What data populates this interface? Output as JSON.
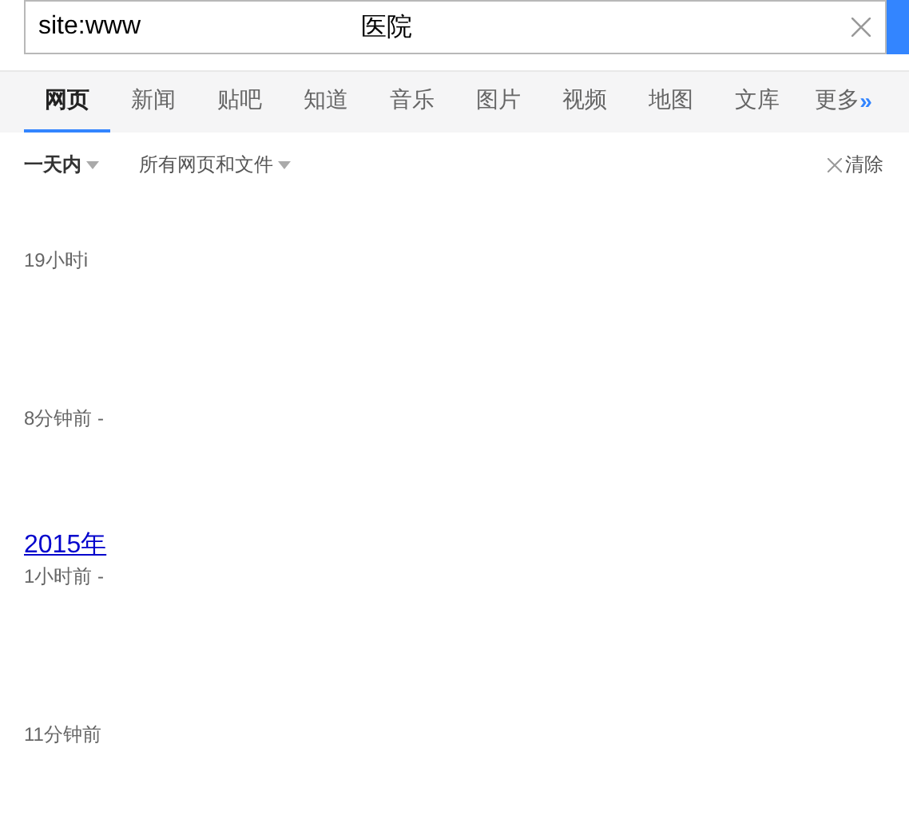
{
  "search": {
    "query_parts": [
      "site:www",
      "医院"
    ]
  },
  "tabs": [
    {
      "label": "网页",
      "selected": true
    },
    {
      "label": "新闻",
      "selected": false
    },
    {
      "label": "贴吧",
      "selected": false
    },
    {
      "label": "知道",
      "selected": false
    },
    {
      "label": "音乐",
      "selected": false
    },
    {
      "label": "图片",
      "selected": false
    },
    {
      "label": "视频",
      "selected": false
    },
    {
      "label": "地图",
      "selected": false
    },
    {
      "label": "文库",
      "selected": false
    },
    {
      "label": "更多",
      "selected": false,
      "suffix": "»"
    }
  ],
  "filters": {
    "time": "一天内",
    "scope": "所有网页和文件",
    "clear": "清除"
  },
  "results": [
    {
      "time": "19小时i"
    },
    {
      "time": "8分钟前 -"
    },
    {
      "title": "2015年",
      "time": "1小时前 -"
    },
    {
      "time": "11分钟前"
    }
  ]
}
